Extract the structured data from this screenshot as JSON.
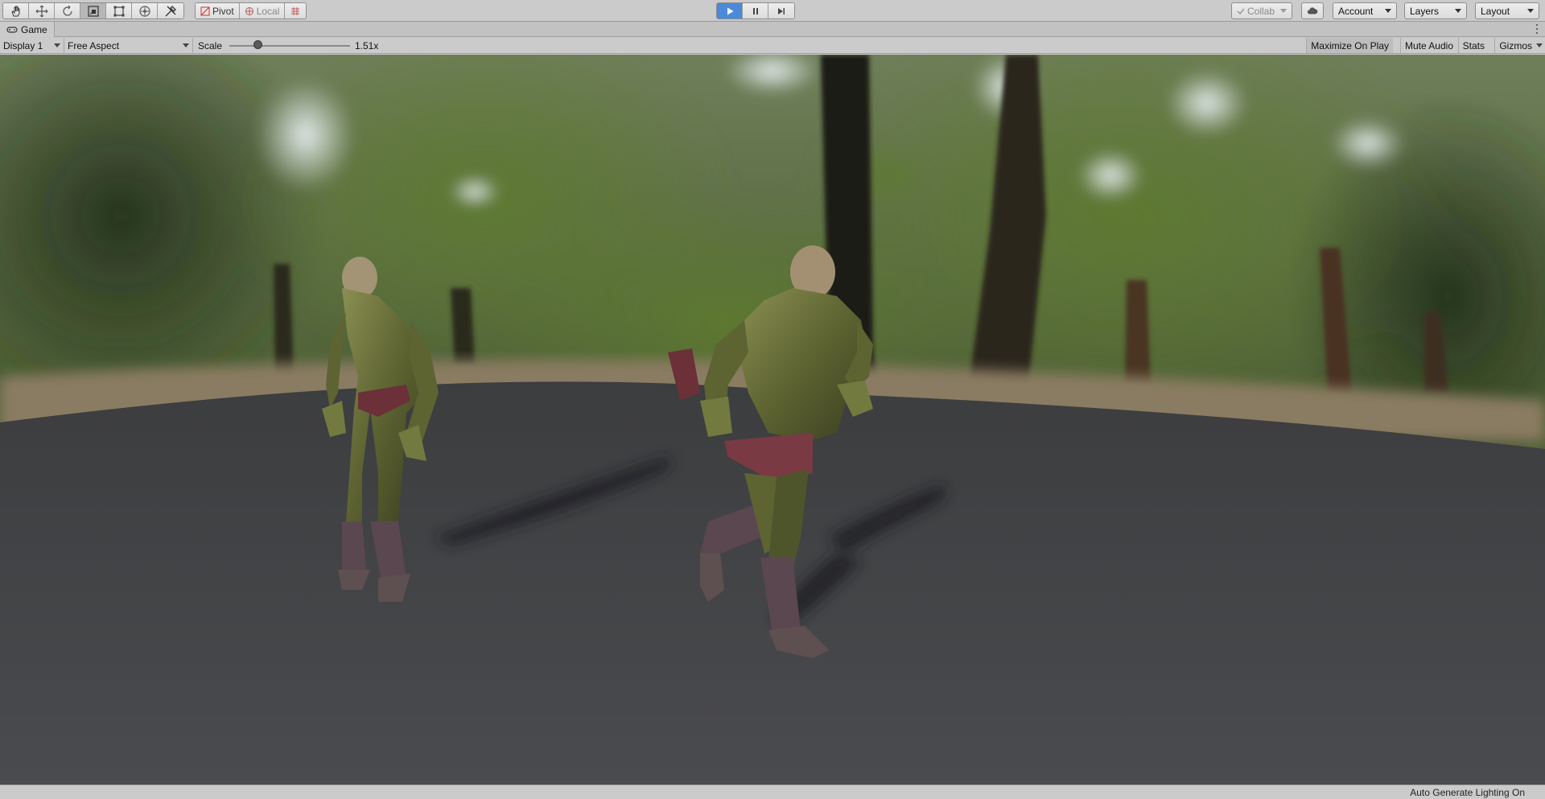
{
  "toolbar": {
    "tools": [
      {
        "icon": "hand-icon"
      },
      {
        "icon": "move-icon"
      },
      {
        "icon": "rotate-icon"
      },
      {
        "icon": "scale-icon"
      },
      {
        "icon": "rect-tool-icon"
      },
      {
        "icon": "transform-icon"
      },
      {
        "icon": "custom-tool-icon"
      }
    ],
    "pivot_label": "Pivot",
    "local_label": "Local",
    "collab_label": "Collab",
    "account_label": "Account",
    "layers_label": "Layers",
    "layout_label": "Layout",
    "play_active": true
  },
  "tab": {
    "title": "Game"
  },
  "gamebar": {
    "display": "Display 1",
    "aspect": "Free Aspect",
    "scale_label": "Scale",
    "scale_value": "1.51x",
    "scale_fraction": 0.23,
    "maximize_label": "Maximize On Play",
    "mute_label": "Mute Audio",
    "stats_label": "Stats",
    "gizmos_label": "Gizmos"
  },
  "status": {
    "text": "Auto Generate Lighting On"
  },
  "colors": {
    "play_accent": "#4a8ad8",
    "toolbar_bg": "#cbcbcb"
  }
}
